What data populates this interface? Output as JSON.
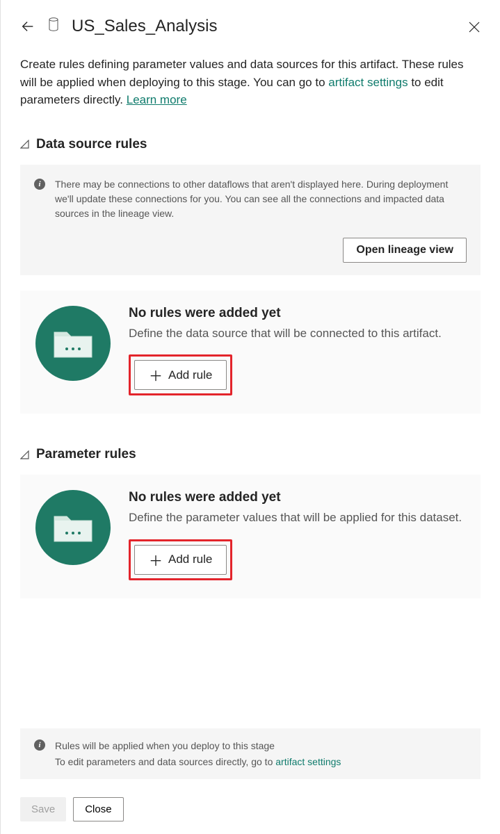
{
  "header": {
    "title": "US_Sales_Analysis"
  },
  "intro": {
    "text_before_link": "Create rules defining parameter values and data sources for this artifact. These rules will be applied when deploying to this stage. You can go to  ",
    "artifact_link": "artifact settings",
    "text_after_link": "  to edit parameters directly. ",
    "learn_more": "Learn more"
  },
  "sections": {
    "datasource": {
      "heading": "Data source rules",
      "info": "There may be connections to other dataflows that aren't displayed here. During deployment we'll update these connections for you. You can see all the connections and impacted data sources in the lineage view.",
      "lineage_button": "Open lineage view",
      "card_title": "No rules were added yet",
      "card_desc": "Define the data source that will be connected to this artifact.",
      "add_button": "Add rule"
    },
    "parameter": {
      "heading": "Parameter rules",
      "card_title": "No rules were added yet",
      "card_desc": "Define the parameter values that will be applied for this dataset.",
      "add_button": "Add rule"
    }
  },
  "footer": {
    "line1": "Rules will be applied when you deploy to this stage",
    "line2_before": "To edit parameters and data sources directly, go to  ",
    "line2_link": "artifact settings",
    "save": "Save",
    "close": "Close"
  }
}
